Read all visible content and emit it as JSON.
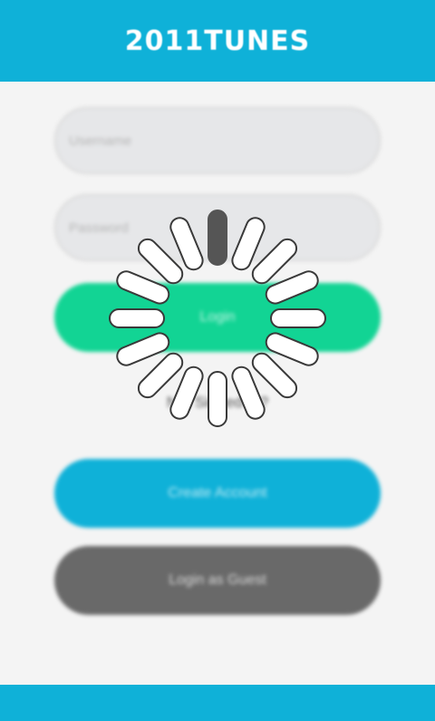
{
  "app": {
    "logo_text": "2011TUNES"
  },
  "form": {
    "username_placeholder": "Username",
    "password_placeholder": "Password",
    "login_label": "Login",
    "forgot_label": "Not Signed In?",
    "create_account_label": "Create Account",
    "guest_label": "Login as Guest"
  },
  "colors": {
    "header": "#0fb1d8",
    "login_button": "#12d494",
    "create_account_button": "#0fb1d8",
    "guest_button": "#696969",
    "footer": "#0fb1d8"
  },
  "loading": {
    "icon": "loading-spinner-icon",
    "spoke_count": 16
  }
}
